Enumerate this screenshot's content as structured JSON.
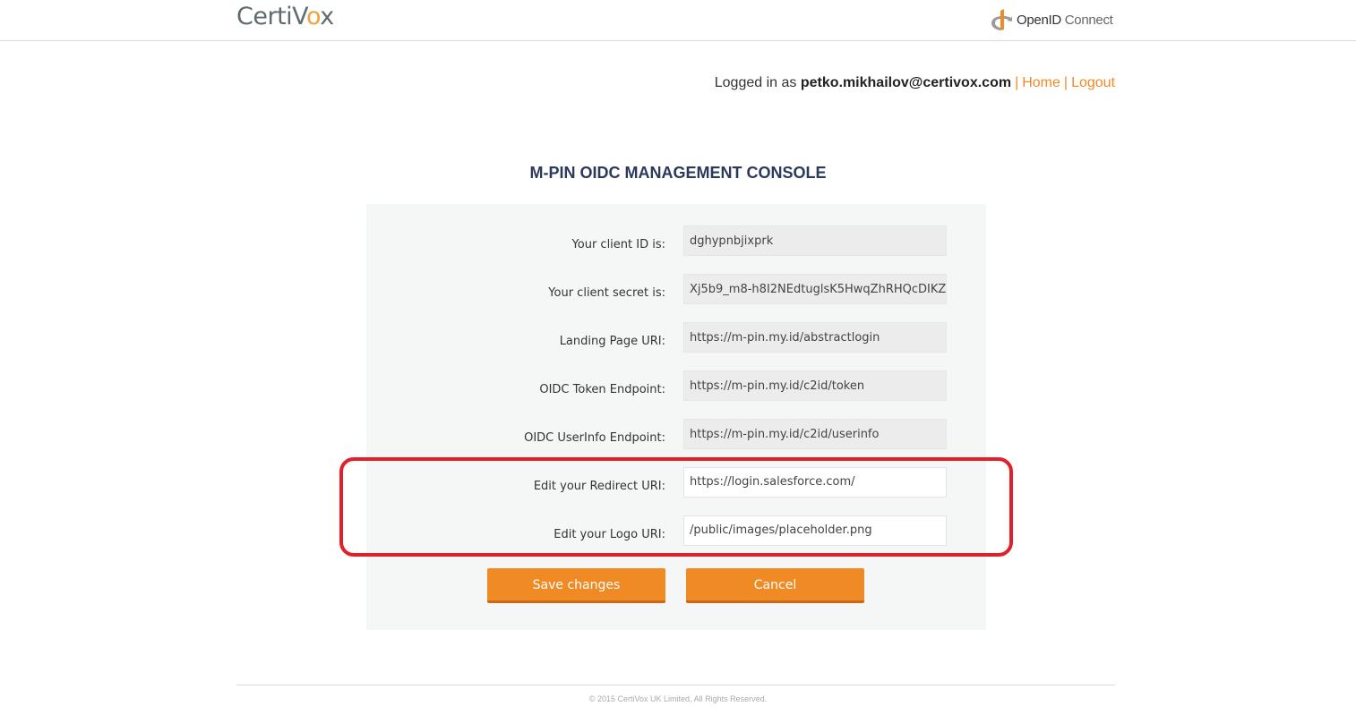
{
  "header": {
    "logo_prefix": "CertiV",
    "logo_o": "o",
    "logo_suffix": "x",
    "openid_brand": "OpenID",
    "openid_connect": " Connect"
  },
  "user": {
    "prefix": "Logged in as ",
    "email": "petko.mikhailov@certivox.com",
    "separator": "|",
    "home_link": "Home",
    "logout_link": "Logout"
  },
  "page_title": "M-PIN OIDC MANAGEMENT CONSOLE",
  "fields": [
    {
      "label": "Your client ID is:",
      "value": "dghypnbjixprk"
    },
    {
      "label": "Your client secret is:",
      "value": "Xj5b9_m8-h8I2NEdtuglsK5HwqZhRHQcDIKZ"
    },
    {
      "label": "Landing Page URI:",
      "value": "https://m-pin.my.id/abstractlogin"
    },
    {
      "label": "OIDC Token Endpoint:",
      "value": "https://m-pin.my.id/c2id/token"
    },
    {
      "label": "OIDC UserInfo Endpoint:",
      "value": "https://m-pin.my.id/c2id/userinfo"
    },
    {
      "label": "Edit your Redirect URI:",
      "value": "https://login.salesforce.com/"
    },
    {
      "label": "Edit your Logo URI:",
      "value": "/public/images/placeholder.png"
    }
  ],
  "buttons": {
    "save": "Save changes",
    "cancel": "Cancel"
  },
  "footer": "© 2015 CertiVox UK Limited, All Rights Reserved.",
  "colors": {
    "accent": "#f08a24",
    "title": "#2b3a5c",
    "highlight": "#e0202a"
  }
}
